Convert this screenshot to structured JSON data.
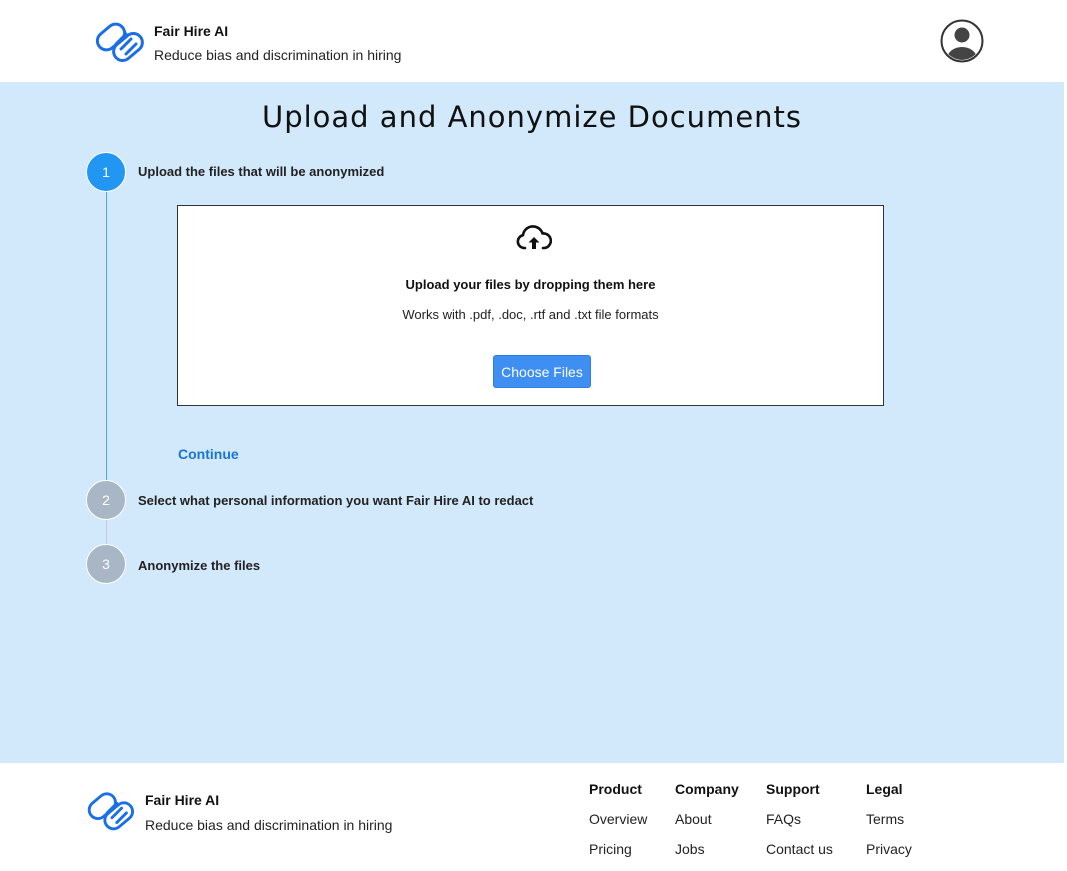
{
  "header": {
    "brand_name": "Fair Hire AI",
    "tagline": "Reduce bias and discrimination in hiring",
    "logo_icon": "handshake-icon",
    "avatar_icon": "user-avatar-icon"
  },
  "main": {
    "title": "Upload and Anonymize Documents",
    "steps": [
      {
        "number": "1",
        "label": "Upload the files that will be anonymized",
        "state": "active"
      },
      {
        "number": "2",
        "label": "Select what personal information you want Fair Hire AI to redact",
        "state": "inactive"
      },
      {
        "number": "3",
        "label": "Anonymize the files",
        "state": "inactive"
      }
    ],
    "upload": {
      "icon": "cloud-upload-icon",
      "title": "Upload your files by dropping them here",
      "subtitle": "Works with .pdf, .doc, .rtf and .txt file formats",
      "button_label": "Choose Files"
    },
    "continue_label": "Continue"
  },
  "footer": {
    "brand_name": "Fair Hire AI",
    "tagline": "Reduce bias and discrimination in hiring",
    "columns": [
      {
        "heading": "Product",
        "links": [
          "Overview",
          "Pricing"
        ]
      },
      {
        "heading": "Company",
        "links": [
          "About",
          "Jobs"
        ]
      },
      {
        "heading": "Support",
        "links": [
          "FAQs",
          "Contact us"
        ]
      },
      {
        "heading": "Legal",
        "links": [
          "Terms",
          "Privacy"
        ]
      }
    ]
  },
  "colors": {
    "accent": "#2196f3",
    "button": "#3f8ef2",
    "link": "#1976d2",
    "main_bg": "#d2e8fb",
    "inactive_step": "#a9b6c6"
  }
}
